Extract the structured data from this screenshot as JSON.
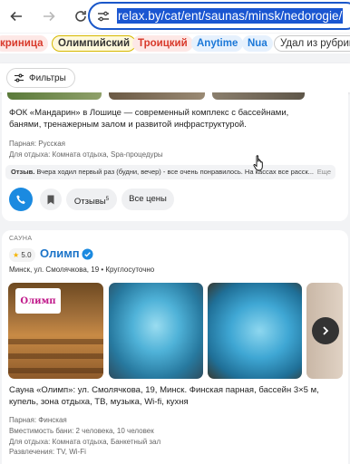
{
  "browser": {
    "url": "relax.by/cat/ent/saunas/minsk/nedorogie/"
  },
  "chips": [
    "криница",
    "Олимпийский",
    "Троицкий",
    "Anytime",
    "Nua",
    "Удал из рубрики"
  ],
  "filters": {
    "label": "Фильтры"
  },
  "card1": {
    "description": "ФОК «Мандарин» в Лошице — современный комплекс с бассейнами, банями, тренажерным залом и развитой инфраструктурой.",
    "meta": [
      "Парная: Русская",
      "Для отдыха: Комната отдыха, Spa-процедуры"
    ],
    "review_label": "Отзыв.",
    "review_text": " Вчера ходил первый раз (будни, вечер) - все очень понравилось. На кассах все расск...",
    "review_more": "Еще",
    "reviews_button": "Отзывы",
    "reviews_count": "5",
    "prices_button": "Все цены"
  },
  "card2": {
    "category": "САУНА",
    "rating": "5.0",
    "name": "Олимп",
    "address": "Минск, ул. Смолячкова, 19  •  Круглосуточно",
    "logo_text": "Олимп",
    "description": "Сауна «Олимп»: ул. Смолячкова, 19, Минск. Финская парная, бассейн 3×5 м, купель, зона отдыха, ТВ, музыка, Wi-fi, кухня",
    "meta": [
      "Парная: Финская",
      "Вместимость бани: 2 человека, 10 человек",
      "Для отдыха: Комната отдыха, Банкетный зал",
      "Развлечения: TV, Wi-Fi"
    ]
  },
  "colors": {
    "accent": "#1a73c8",
    "url_highlight": "#1a56d1",
    "call": "#1b8ae0"
  }
}
